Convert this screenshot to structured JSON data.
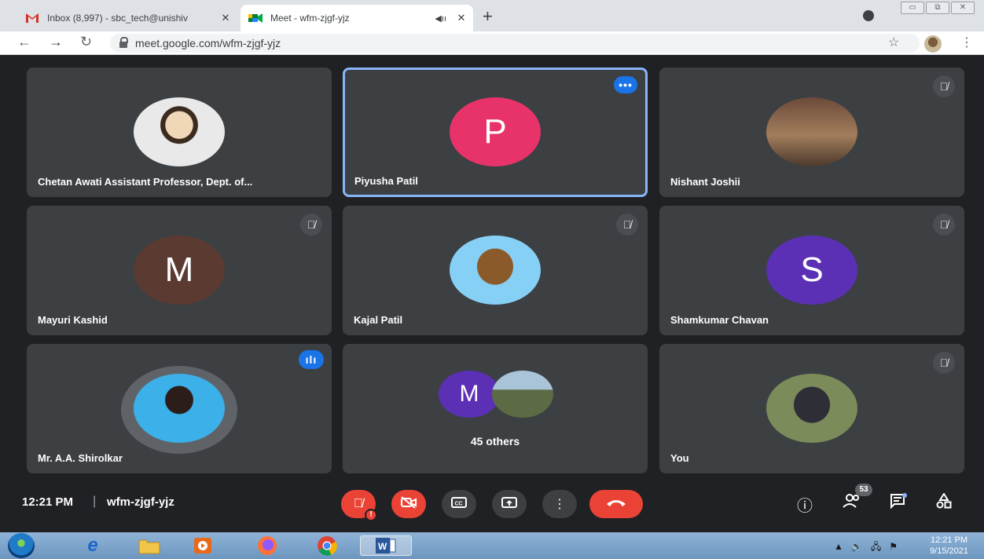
{
  "browser": {
    "tabs": [
      {
        "title": "Inbox (8,997) - sbc_tech@unishiv",
        "active": false
      },
      {
        "title": "Meet - wfm-zjgf-yjz",
        "active": true
      }
    ],
    "new_tab": "+",
    "url": "meet.google.com/wfm-zjgf-yjz"
  },
  "participants": [
    {
      "name": "Chetan Awati Assistant Professor, Dept. of...",
      "type": "photo"
    },
    {
      "name": "Piyusha Patil",
      "initial": "P",
      "color": "#e8336a",
      "pinned_more": "•••"
    },
    {
      "name": "Nishant Joshii",
      "type": "photo",
      "muted": true
    },
    {
      "name": "Mayuri Kashid",
      "initial": "M",
      "color": "#5a3a31",
      "muted": true
    },
    {
      "name": "Kajal Patil",
      "type": "photo",
      "muted": true
    },
    {
      "name": "Shamkumar Chavan",
      "initial": "S",
      "color": "#5b30b5",
      "muted": true
    },
    {
      "name": "Mr. A.A. Shirolkar",
      "type": "photo",
      "speaking": true
    },
    {
      "others_label": "45 others",
      "initial": "M",
      "color": "#5b30b5"
    },
    {
      "name": "You",
      "type": "photo",
      "muted": true
    }
  ],
  "meeting": {
    "time": "12:21 PM",
    "separator": "|",
    "code": "wfm-zjgf-yjz",
    "participant_count": "53",
    "mic_alert": "!"
  },
  "taskbar": {
    "clock_time": "12:21 PM",
    "clock_date": "9/15/2021"
  },
  "colors": {
    "background": "#202124",
    "tile": "#3c4043",
    "end_call": "#ea4335",
    "active_border": "#8ab4f8"
  }
}
